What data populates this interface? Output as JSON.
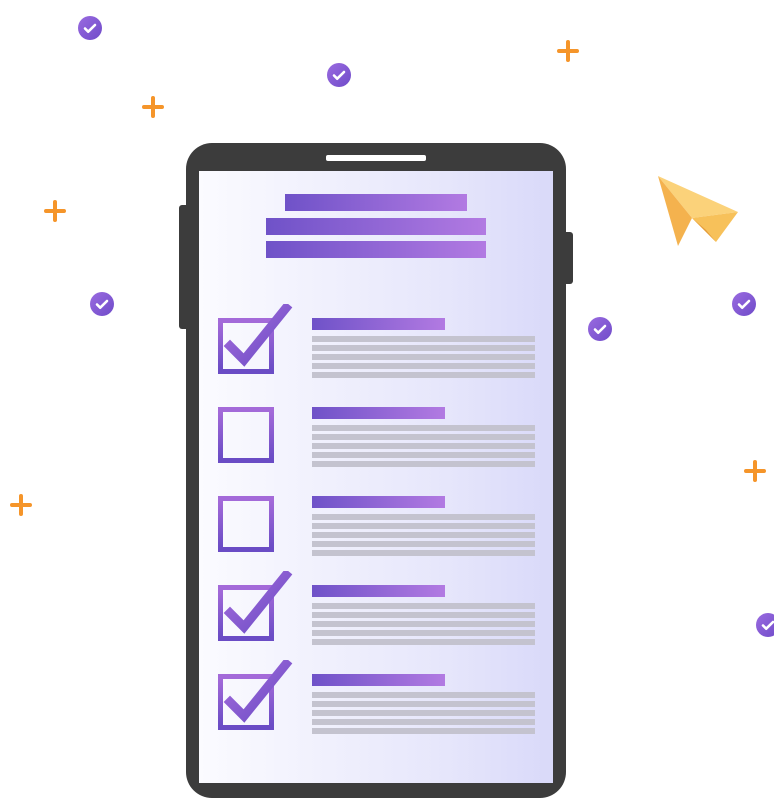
{
  "illustration": {
    "subject": "smartphone-checklist",
    "colors": {
      "phone_frame": "#3c3c3c",
      "accent_gradient_start": "#6f52c8",
      "accent_gradient_end": "#b27ae2",
      "plus_orange": "#f5952a",
      "placeholder_line": "#c4c3cf",
      "plane": "#f7c15a"
    },
    "checklist": [
      {
        "checked": true
      },
      {
        "checked": false
      },
      {
        "checked": false
      },
      {
        "checked": true
      },
      {
        "checked": true
      }
    ],
    "icons": [
      "check-circle-icon",
      "plus-icon",
      "paper-plane-icon"
    ]
  }
}
